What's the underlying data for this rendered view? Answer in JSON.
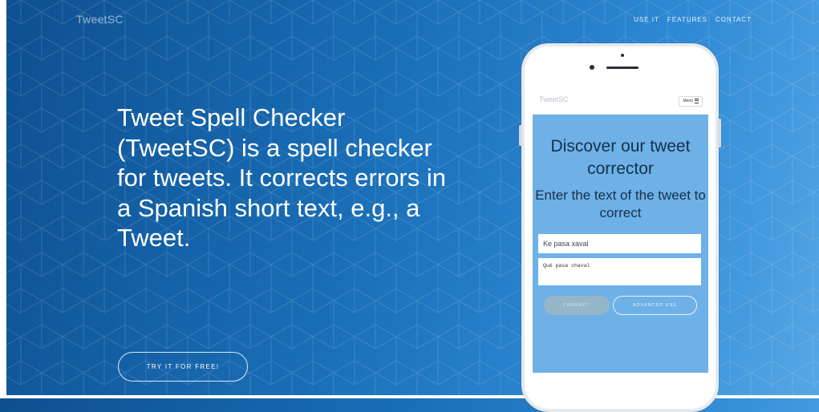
{
  "site": {
    "brand": "TweetSC"
  },
  "nav": {
    "items": [
      "USE IT",
      "FEATURES",
      "CONTACT"
    ]
  },
  "hero": {
    "text": "Tweet Spell Checker (TweetSC) is a spell checker for tweets. It corrects errors in a Spanish short text, e.g., a Tweet.",
    "cta_label": "TRY IT FOR FREE!"
  },
  "phone": {
    "brand": "TweetSC",
    "menu_label": "Menu",
    "title": "Discover our tweet corrector",
    "subtitle": "Enter the text of the tweet to correct",
    "input_value": "Ke pasa xaval",
    "output_text": "Qué pasa chaval",
    "correct_label": "CORRECT",
    "advanced_label": "ADVANCED USE"
  },
  "colors": {
    "background_start": "#0d4f90",
    "background_end": "#56a7e6",
    "phone_screen": "#6eb1e7",
    "heading_text": "#14304c"
  },
  "icons": {
    "menu": "hamburger-icon"
  }
}
